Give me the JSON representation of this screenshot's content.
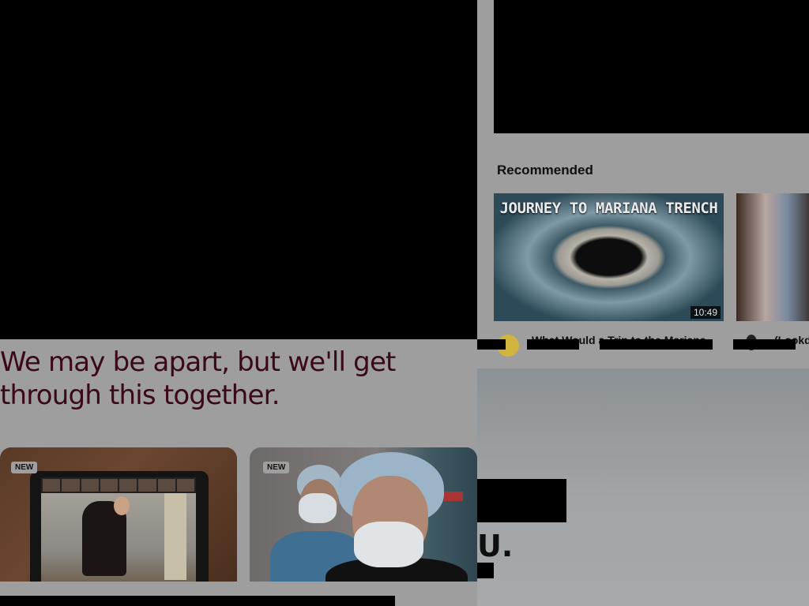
{
  "left": {
    "headline": "We may be apart, but we'll get through this together.",
    "cards": [
      {
        "badge": "NEW"
      },
      {
        "badge": "NEW"
      }
    ]
  },
  "right": {
    "recommended_heading": "Recommended",
    "videos": [
      {
        "thumbnail_caption": "JOURNEY TO MARIANA TRENCH",
        "duration": "10:49",
        "title": "What Would a Trip to the Mariana"
      },
      {
        "title": "(Lookd"
      }
    ],
    "sky_fragment": "U."
  }
}
